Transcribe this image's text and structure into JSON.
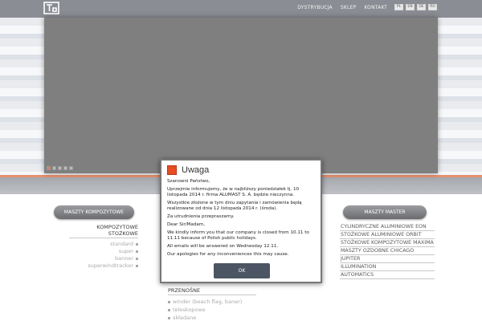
{
  "header": {
    "nav": [
      "DYSTRYBUCJA",
      "SKLEP",
      "KONTAKT"
    ],
    "languages": [
      "PL",
      "EN",
      "DE",
      "RU"
    ]
  },
  "slider": {
    "slide_count": 5,
    "active_slide": 1
  },
  "left_column": {
    "button_label": "MASZTY KOMPOZYTOWE",
    "group_title": "KOMPOZYTOWE STOŻKOWE",
    "items": [
      "standard",
      "super",
      "banner",
      "superwindtracker"
    ]
  },
  "middle_column": {
    "group_title": "PRZENOŚNE",
    "items": [
      "winder (beach flag, baner)",
      "teleskopowe",
      "składane"
    ]
  },
  "right_column": {
    "button_label": "MASZTY MASTER",
    "items": [
      "CYLINDRYCZNE ALUMINIOWE EON",
      "STOŻKOWE ALUMINIOWE ORBIT",
      "STOŻKOWE KOMPOZYTOWE MAXIMA",
      "MASZTY OZDOBNE CHICAGO",
      "JUPITER",
      "ILLUMINATION",
      "AUTOMATICS"
    ]
  },
  "modal": {
    "title": "Uwaga",
    "paragraphs": [
      "Szanowni Państwo,",
      "Uprzejmie informujemy, że w najbliższy poniedziałek tj. 10 listopada 2014 r. firma ALUMAST S. A. będzie nieczynna.",
      "Wszystkie złożone w tym dniu zapytania i zamówienia będą realizowane od dnia 12 listopada 2014 r. (środa).",
      "Za utrudnienia przepraszamy.",
      "Dear Sir/Madam,",
      "We kindly inform you that our company is closed from 10.11 to 11.11 because of Polish public holidays.",
      "All emails will be answered on Wednesday 12.11.",
      "Our apologies for any inconveniences this may cause."
    ],
    "ok_label": "OK"
  },
  "colors": {
    "accent": "#e84c22",
    "topbar": "#8a8d93",
    "button": "#4c5563"
  }
}
